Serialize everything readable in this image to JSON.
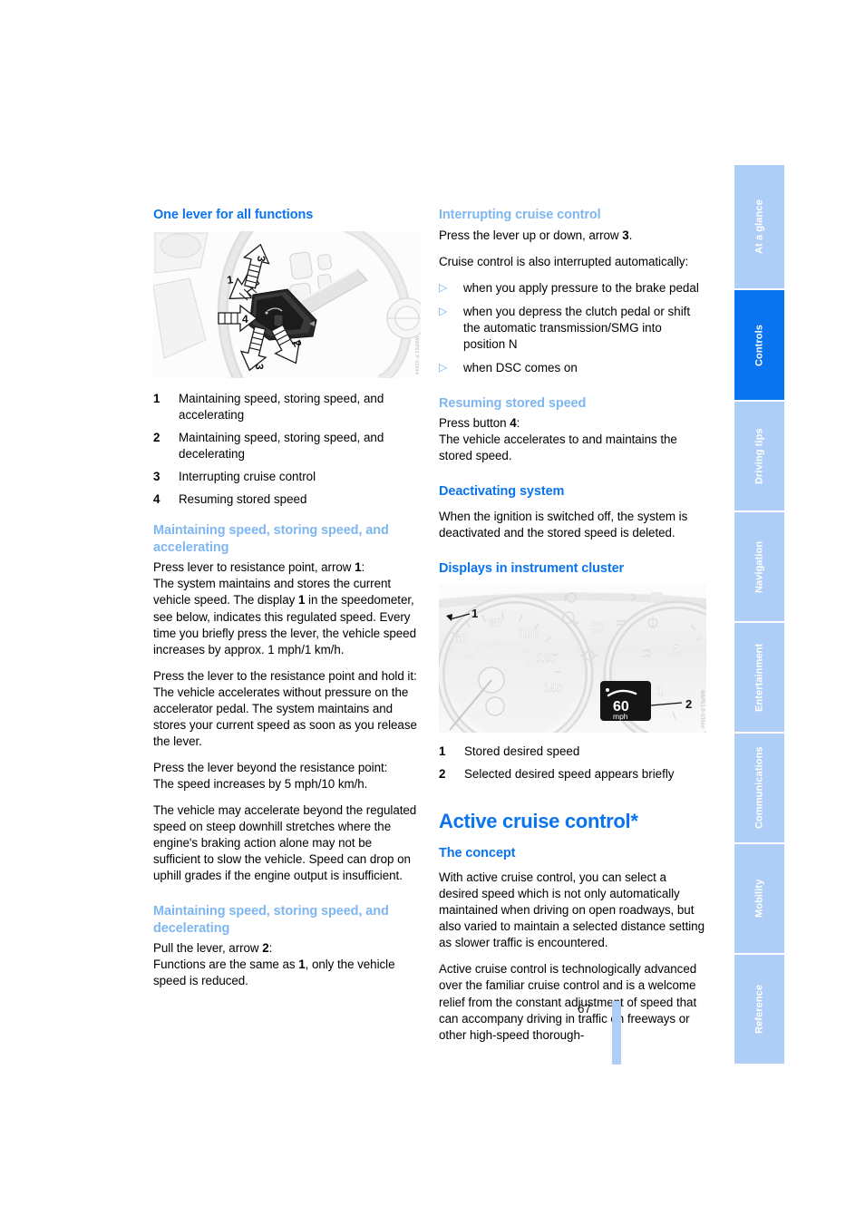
{
  "page": {
    "number": "67",
    "accent_dark": "#0a74f0",
    "accent_light": "#7eb6f2",
    "tab_bg": "#aecdf7"
  },
  "sidebar": {
    "tabs": [
      {
        "label": "At a glance",
        "active": false
      },
      {
        "label": "Controls",
        "active": true
      },
      {
        "label": "Driving tips",
        "active": false
      },
      {
        "label": "Navigation",
        "active": false
      },
      {
        "label": "Entertainment",
        "active": false
      },
      {
        "label": "Communications",
        "active": false
      },
      {
        "label": "Mobility",
        "active": false
      },
      {
        "label": "Reference",
        "active": false
      }
    ]
  },
  "left_column": {
    "heading_one_lever": "One lever for all functions",
    "figure_lever": {
      "code": "WAP51.P-0354#",
      "callouts": [
        "1",
        "2",
        "3",
        "3",
        "4"
      ]
    },
    "lever_legend": [
      {
        "num": "1",
        "text": "Maintaining speed, storing speed, and accelerating"
      },
      {
        "num": "2",
        "text": "Maintaining speed, storing speed, and decelerating"
      },
      {
        "num": "3",
        "text": "Interrupting cruise control"
      },
      {
        "num": "4",
        "text": "Resuming stored speed"
      }
    ],
    "heading_accelerating": "Maintaining speed, storing speed, and accelerating",
    "para_accel_1_a": "Press lever to resistance point, arrow ",
    "para_accel_1_b": "1",
    "para_accel_1_c": ":",
    "para_accel_2_a": "The system maintains and stores the current vehicle speed. The display ",
    "para_accel_2_b": "1",
    "para_accel_2_c": " in the speedometer, see below, indicates this regulated speed. Every time you briefly press the lever, the vehicle speed increases by approx. 1 mph/1 km/h.",
    "para_accel_3": "Press the lever to the resistance point and hold it:",
    "para_accel_4": "The vehicle accelerates without pressure on the accelerator pedal. The system maintains and stores your current speed as soon as you release the lever.",
    "para_accel_5": "Press the lever beyond the resistance point:",
    "para_accel_6": "The speed increases by 5 mph/10 km/h.",
    "para_accel_7": "The vehicle may accelerate beyond the regulated speed on steep downhill stretches where the engine's braking action alone may not be sufficient to slow the vehicle. Speed can drop on uphill grades if the engine output is insufficient.",
    "heading_decelerating": "Maintaining speed, storing speed, and decelerating",
    "para_decel_1_a": "Pull the lever, arrow ",
    "para_decel_1_b": "2",
    "para_decel_1_c": ":",
    "para_decel_2_a": "Functions are the same as ",
    "para_decel_2_b": "1",
    "para_decel_2_c": ", only the vehicle speed is reduced."
  },
  "right_column": {
    "heading_interrupting": "Interrupting cruise control",
    "para_interrupt_1_a": "Press the lever up or down, arrow ",
    "para_interrupt_1_b": "3",
    "para_interrupt_1_c": ".",
    "para_interrupt_2": "Cruise control is also interrupted automatically:",
    "interrupt_bullets": [
      "when you apply pressure to the brake pedal",
      "when you depress the clutch pedal or shift the automatic transmission/SMG into position N",
      "when DSC comes on"
    ],
    "heading_resuming": "Resuming stored speed",
    "para_resume_1_a": "Press button ",
    "para_resume_1_b": "4",
    "para_resume_1_c": ":",
    "para_resume_2": "The vehicle accelerates to and maintains the stored speed.",
    "heading_deactivating": "Deactivating system",
    "para_deactivate": "When the ignition is switched off, the system is deactivated and the stored speed is deleted.",
    "heading_displays": "Displays in instrument cluster",
    "figure_cluster": {
      "code": "WAP51.P-0354#",
      "speed_value": "60",
      "speed_unit": "mph",
      "dial_labels": [
        "60",
        "80",
        "100",
        "120",
        "140"
      ],
      "tach_labels": [
        "1",
        "2"
      ],
      "callouts": [
        "1",
        "2"
      ]
    },
    "cluster_legend": [
      {
        "num": "1",
        "text": "Stored desired speed"
      },
      {
        "num": "2",
        "text": "Selected desired speed appears briefly"
      }
    ],
    "heading_active_cruise": "Active cruise control*",
    "heading_concept": "The concept",
    "para_concept_1": "With active cruise control, you can select a desired speed which is not only automatically maintained when driving on open roadways, but also varied to maintain a selected distance setting as slower traffic is encountered.",
    "para_concept_2": "Active cruise control is technologically advanced over the familiar cruise control and is a welcome relief from the constant adjustment of speed that can accompany driving in traffic on freeways or other high-speed thorough-"
  }
}
